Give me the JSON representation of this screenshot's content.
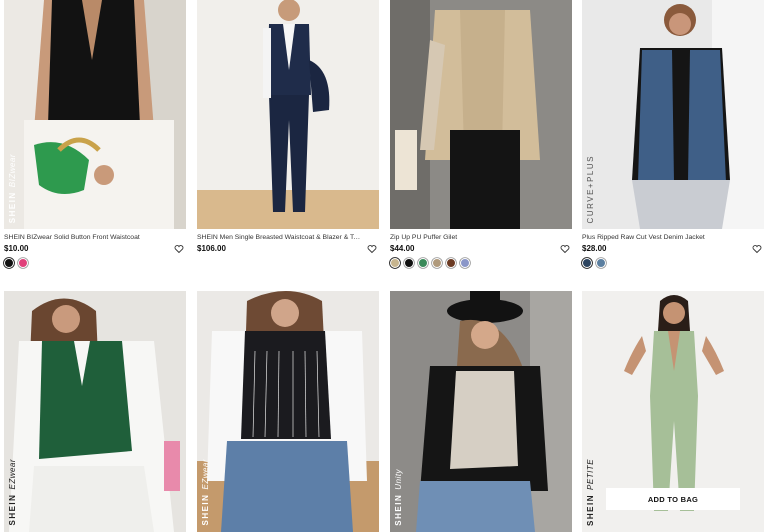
{
  "products": [
    {
      "title": "SHEIN BIZwear Solid Button Front Waistcoat",
      "price": "$10.00",
      "brand_tag": "SHEIN",
      "brand_sub": "BIZwear",
      "colors": [
        "#111111",
        "#e0407a"
      ],
      "selected": 0,
      "brand_light": true
    },
    {
      "title": "SHEIN Men Single Breasted Waistcoat & Blazer & Tailored Pants",
      "price": "$106.00",
      "brand_tag": "",
      "brand_sub": "",
      "colors": [],
      "selected": -1,
      "brand_light": false
    },
    {
      "title": "Zip Up PU Puffer Gilet",
      "price": "$44.00",
      "brand_tag": "",
      "brand_sub": "",
      "colors": [
        "#c7b58f",
        "#111111",
        "#3a8a5a",
        "#b09a7c",
        "#6b3a22",
        "#8a96c8"
      ],
      "selected": 0,
      "brand_light": false
    },
    {
      "title": "Plus Ripped Raw Cut Vest Denim Jacket",
      "price": "$28.00",
      "brand_tag": "CURVE+PLUS",
      "brand_sub": "",
      "colors": [
        "#2d4560",
        "#5b7fa0"
      ],
      "selected": 0,
      "brand_light": false
    },
    {
      "title": "",
      "price": "",
      "brand_tag": "SHEIN",
      "brand_sub": "EZwear",
      "colors": [],
      "selected": -1,
      "brand_light": false
    },
    {
      "title": "",
      "price": "",
      "brand_tag": "SHEIN",
      "brand_sub": "EZwear",
      "colors": [],
      "selected": -1,
      "brand_light": true
    },
    {
      "title": "",
      "price": "",
      "brand_tag": "SHEIN",
      "brand_sub": "Unity",
      "colors": [],
      "selected": -1,
      "brand_light": true
    },
    {
      "title": "",
      "price": "",
      "brand_tag": "SHEIN",
      "brand_sub": "PETITE",
      "colors": [],
      "selected": -1,
      "brand_light": false
    }
  ],
  "add_to_bag_label": "ADD TO BAG",
  "icons": {
    "wishlist": "heart-icon"
  }
}
